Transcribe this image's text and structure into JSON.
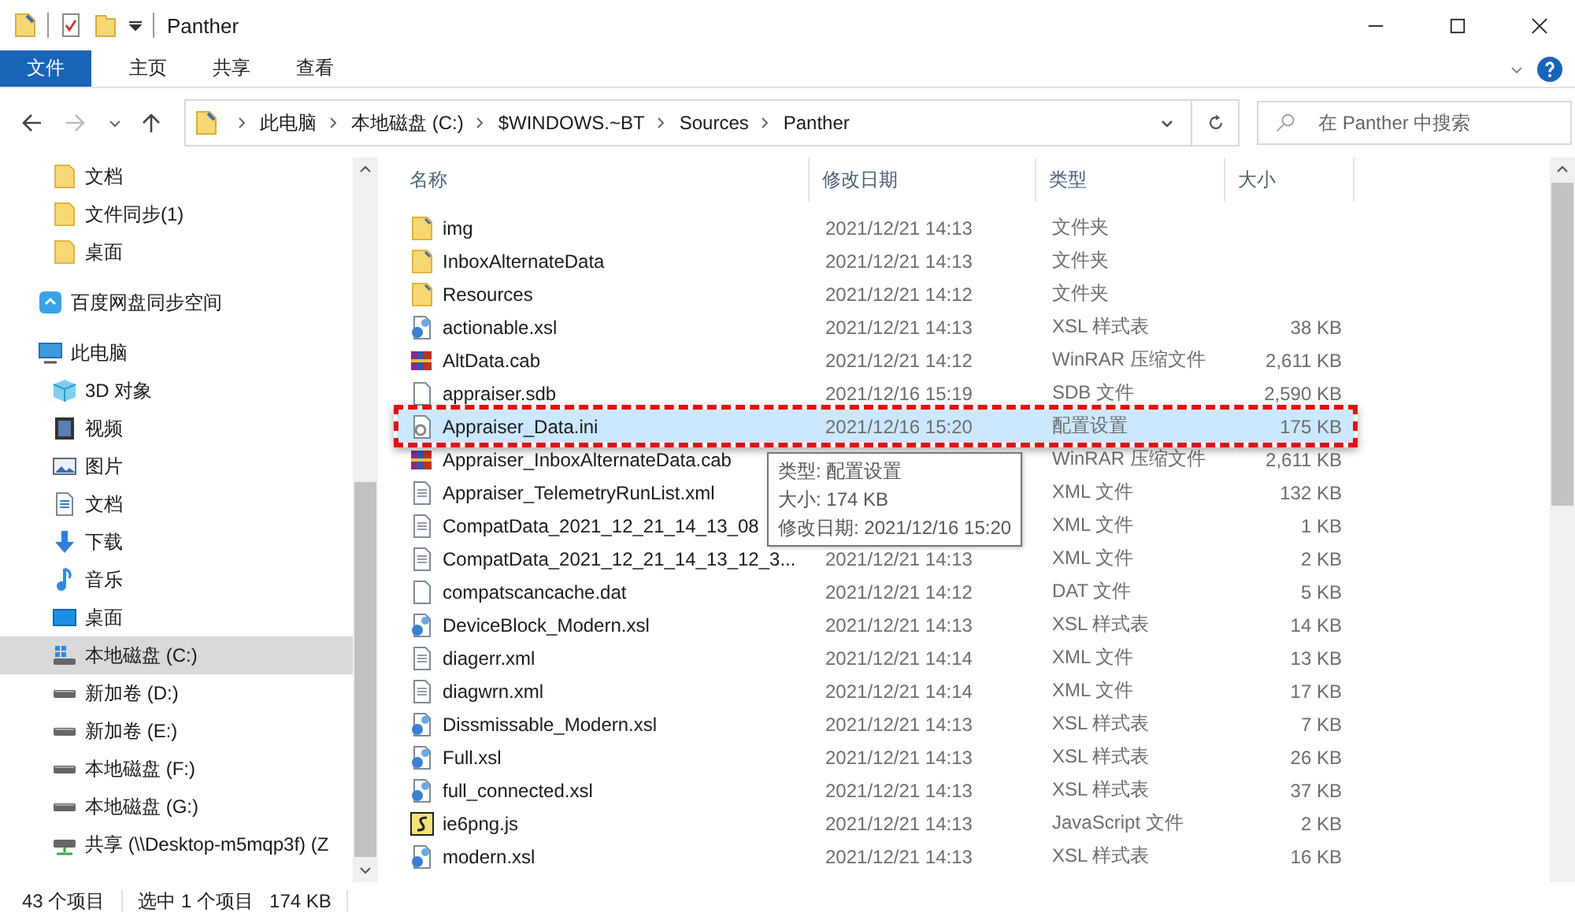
{
  "window": {
    "title": "Panther"
  },
  "ribbon": {
    "tabs": [
      {
        "label": "文件",
        "kind": "file"
      },
      {
        "label": "主页",
        "kind": "tab"
      },
      {
        "label": "共享",
        "kind": "tab"
      },
      {
        "label": "查看",
        "kind": "tab"
      }
    ]
  },
  "address": {
    "path": [
      "此电脑",
      "本地磁盘 (C:)",
      "$WINDOWS.~BT",
      "Sources",
      "Panther"
    ]
  },
  "search": {
    "placeholder": "在 Panther 中搜索"
  },
  "sidebar": {
    "continued_items": [
      {
        "label": "文档",
        "kind": "folder",
        "selected": false
      },
      {
        "label": "文件同步(1)",
        "kind": "folder",
        "selected": false
      },
      {
        "label": "桌面",
        "kind": "folder",
        "selected": false
      }
    ],
    "items": [
      {
        "label": "百度网盘同步空间",
        "kind": "cloud",
        "selected": false
      },
      {
        "label": "此电脑",
        "kind": "pc",
        "selected": false,
        "children": [
          {
            "label": "3D 对象",
            "kind": "cube",
            "selected": false
          },
          {
            "label": "视频",
            "kind": "video",
            "selected": false
          },
          {
            "label": "图片",
            "kind": "picture",
            "selected": false
          },
          {
            "label": "文档",
            "kind": "document",
            "selected": false
          },
          {
            "label": "下载",
            "kind": "download",
            "selected": false
          },
          {
            "label": "音乐",
            "kind": "music",
            "selected": false
          },
          {
            "label": "桌面",
            "kind": "desktop",
            "selected": false
          },
          {
            "label": "本地磁盘 (C:)",
            "kind": "system-drive",
            "selected": true
          },
          {
            "label": "新加卷 (D:)",
            "kind": "drive",
            "selected": false
          },
          {
            "label": "新加卷 (E:)",
            "kind": "drive",
            "selected": false
          },
          {
            "label": "本地磁盘 (F:)",
            "kind": "drive",
            "selected": false
          },
          {
            "label": "本地磁盘 (G:)",
            "kind": "drive",
            "selected": false
          },
          {
            "label": "共享 (\\\\Desktop-m5mqp3f) (Z",
            "kind": "network-drive",
            "selected": false
          }
        ]
      }
    ]
  },
  "table": {
    "columns": [
      "名称",
      "修改日期",
      "类型",
      "大小"
    ],
    "rows": [
      {
        "name": "img",
        "date": "2021/12/21 14:13",
        "type": "文件夹",
        "size": "",
        "kind": "folder",
        "selected": false,
        "highlighted": false
      },
      {
        "name": "InboxAlternateData",
        "date": "2021/12/21 14:13",
        "type": "文件夹",
        "size": "",
        "kind": "folder",
        "selected": false,
        "highlighted": false
      },
      {
        "name": "Resources",
        "date": "2021/12/21 14:12",
        "type": "文件夹",
        "size": "",
        "kind": "folder",
        "selected": false,
        "highlighted": false
      },
      {
        "name": "actionable.xsl",
        "date": "2021/12/21 14:13",
        "type": "XSL 样式表",
        "size": "38 KB",
        "kind": "xsl",
        "selected": false,
        "highlighted": false
      },
      {
        "name": "AltData.cab",
        "date": "2021/12/21 14:12",
        "type": "WinRAR 压缩文件",
        "size": "2,611 KB",
        "kind": "rar",
        "selected": false,
        "highlighted": false
      },
      {
        "name": "appraiser.sdb",
        "date": "2021/12/16 15:19",
        "type": "SDB 文件",
        "size": "2,590 KB",
        "kind": "file",
        "selected": false,
        "highlighted": false
      },
      {
        "name": "Appraiser_Data.ini",
        "date": "2021/12/16 15:20",
        "type": "配置设置",
        "size": "175 KB",
        "kind": "ini",
        "selected": true,
        "highlighted": true
      },
      {
        "name": "Appraiser_InboxAlternateData.cab",
        "type": "WinRAR 压缩文件",
        "size": "2,611 KB",
        "kind": "rar",
        "selected": false,
        "highlighted": false
      },
      {
        "name": "Appraiser_TelemetryRunList.xml",
        "type": "XML 文件",
        "size": "132 KB",
        "kind": "xml",
        "selected": false,
        "highlighted": false
      },
      {
        "name": "CompatData_2021_12_21_14_13_08",
        "type": "XML 文件",
        "size": "1 KB",
        "kind": "xml",
        "selected": false,
        "highlighted": false
      },
      {
        "name": "CompatData_2021_12_21_14_13_12_3...",
        "date": "2021/12/21 14:13",
        "type": "XML 文件",
        "size": "2 KB",
        "kind": "xml",
        "selected": false,
        "highlighted": false
      },
      {
        "name": "compatscancache.dat",
        "date": "2021/12/21 14:12",
        "type": "DAT 文件",
        "size": "5 KB",
        "kind": "file",
        "selected": false,
        "highlighted": false
      },
      {
        "name": "DeviceBlock_Modern.xsl",
        "date": "2021/12/21 14:13",
        "type": "XSL 样式表",
        "size": "14 KB",
        "kind": "xsl",
        "selected": false,
        "highlighted": false
      },
      {
        "name": "diagerr.xml",
        "date": "2021/12/21 14:14",
        "type": "XML 文件",
        "size": "13 KB",
        "kind": "xml",
        "selected": false,
        "highlighted": false
      },
      {
        "name": "diagwrn.xml",
        "date": "2021/12/21 14:14",
        "type": "XML 文件",
        "size": "17 KB",
        "kind": "xml",
        "selected": false,
        "highlighted": false
      },
      {
        "name": "Dissmissable_Modern.xsl",
        "date": "2021/12/21 14:13",
        "type": "XSL 样式表",
        "size": "7 KB",
        "kind": "xsl",
        "selected": false,
        "highlighted": false
      },
      {
        "name": "Full.xsl",
        "date": "2021/12/21 14:13",
        "type": "XSL 样式表",
        "size": "26 KB",
        "kind": "xsl",
        "selected": false,
        "highlighted": false
      },
      {
        "name": "full_connected.xsl",
        "date": "2021/12/21 14:13",
        "type": "XSL 样式表",
        "size": "37 KB",
        "kind": "xsl",
        "selected": false,
        "highlighted": false
      },
      {
        "name": "ie6png.js",
        "date": "2021/12/21 14:13",
        "type": "JavaScript 文件",
        "size": "2 KB",
        "kind": "js",
        "selected": false,
        "highlighted": false
      },
      {
        "name": "modern.xsl",
        "date": "2021/12/21 14:13",
        "type": "XSL 样式表",
        "size": "16 KB",
        "kind": "xsl",
        "selected": false,
        "highlighted": false
      }
    ]
  },
  "tooltip": {
    "lines": [
      "类型: 配置设置",
      "大小: 174 KB",
      "修改日期: 2021/12/16 15:20"
    ]
  },
  "status_bar": {
    "count": "43 个项目",
    "selection": "选中 1 个项目",
    "size": "174 KB"
  }
}
